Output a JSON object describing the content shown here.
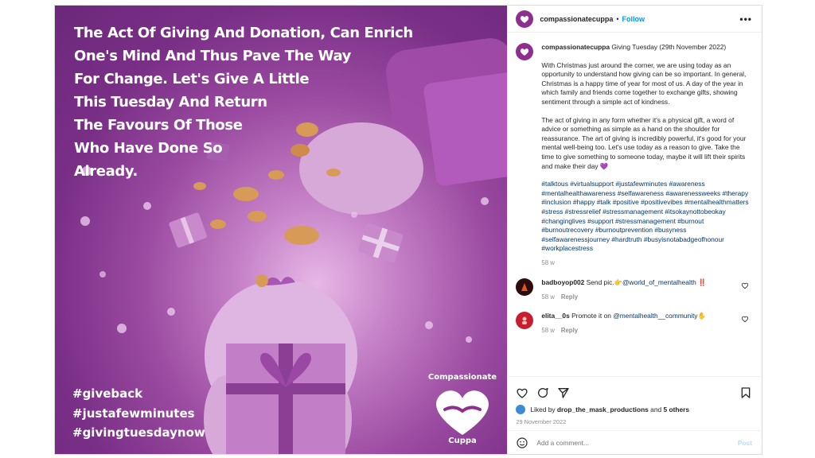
{
  "image": {
    "quote_lines": [
      "The Act Of Giving And Donation, Can Enrich",
      "One's Mind And Thus Pave The Way",
      "For Change. Let's Give A Little",
      "This Tuesday And Return",
      "The Favours Of Those",
      "Who Have Done So",
      "Already."
    ],
    "hashtags": [
      "#giveback",
      "#justafewminutes",
      "#givingtuesdaynow"
    ],
    "logo_arc": "Compassionate",
    "logo_word": "Cuppa"
  },
  "header": {
    "username": "compassionatecuppa",
    "separator": "•",
    "follow_label": "Follow",
    "more_label": "•••"
  },
  "caption": {
    "username": "compassionatecuppa",
    "title": "Giving Tuesday (29th November 2022)",
    "para1": "With Christmas just around the corner, we are using today as an opportunity to understand how giving can be so important. In general, Christmas is a happy time of year for most of us. A day of the year in which family and friends come together to exchange gifts, showing sentiment through a simple act of kindness.",
    "para2": "The act of giving in any form whether it's a physical gift, a word of advice or something as simple as a hand on the shoulder for reassurance. The art of giving is incredibly powerful, it's good for your mental well-being too. Let's use today as a reason to give. Take the time to give something to someone today, maybe it will lift their spirits and make their day 💜",
    "hashtags": "#talktous #virtualsupport #justafewminutes #awareness #mentalhealthawareness #selfawareness #awarenessweeks #therapy #inclusion #happy #talk #positive #positivevibes #mentalhealthmatters #stress #stressrelief #stressmanagement #itsokaynottobeokay #changinglives #support #stressmanagement #burnout #burnoutrecovery #burnoutprevention #busyness #selfawarenessjourney #hardtruth #busyisnotabadgeofhonour #workplacestress",
    "time": "58 w"
  },
  "comments": [
    {
      "username": "badboyop002",
      "text": "Send pic.👉",
      "mention": "@world_of_mentalhealth",
      "suffix": " ‼️",
      "time": "58 w",
      "reply": "Reply",
      "avatar_color": "#2b0d0d"
    },
    {
      "username": "elita__0s",
      "text": "Promote it on",
      "mention": "@mentalhealth__community",
      "suffix": "✋",
      "time": "58 w",
      "reply": "Reply",
      "avatar_color": "#c81d2e"
    }
  ],
  "likes": {
    "prefix": "Liked by",
    "user": "drop_the_mask_productions",
    "connector": "and",
    "others": "5 others"
  },
  "date": "29 November 2022",
  "add_comment": {
    "placeholder": "Add a comment...",
    "post_label": "Post"
  }
}
